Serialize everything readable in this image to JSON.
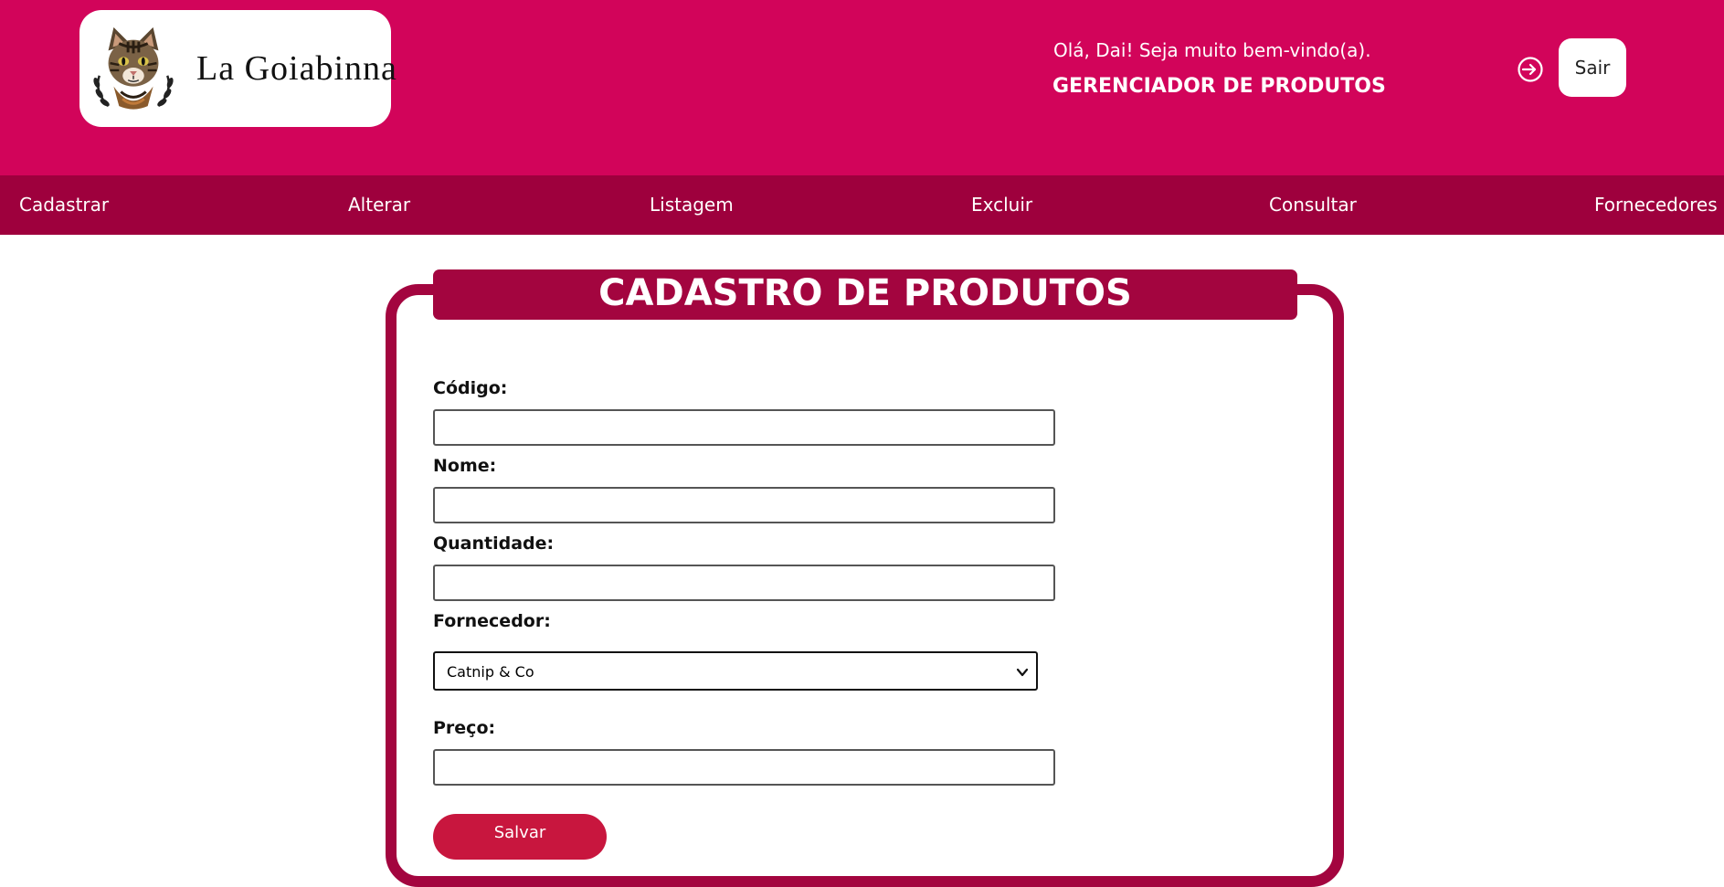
{
  "brand": {
    "name": "La Goiabinna",
    "logo_icon": "cat-face-icon"
  },
  "header": {
    "greeting": "Olá, Dai! Seja muito bem-vindo(a).",
    "title": "GERENCIADOR DE PRODUTOS",
    "logout_icon": "sign-in-arrow-icon",
    "logout_label": "Sair"
  },
  "nav": {
    "items": [
      {
        "label": "Cadastrar"
      },
      {
        "label": "Alterar"
      },
      {
        "label": "Listagem"
      },
      {
        "label": "Excluir"
      },
      {
        "label": "Consultar"
      },
      {
        "label": "Fornecedores"
      }
    ]
  },
  "form": {
    "title": "CADASTRO DE PRODUTOS",
    "fields": {
      "codigo": {
        "label": "Código:",
        "value": ""
      },
      "nome": {
        "label": "Nome:",
        "value": ""
      },
      "quantidade": {
        "label": "Quantidade:",
        "value": ""
      },
      "fornecedor": {
        "label": "Fornecedor:",
        "selected": "Catnip & Co"
      },
      "preco": {
        "label": "Preço:",
        "value": ""
      }
    },
    "submit_label": "Salvar"
  },
  "colors": {
    "header_bg": "#d2045a",
    "nav_bg": "#9e003d",
    "panel_accent": "#a3053f",
    "button_bg": "#c8163e"
  }
}
